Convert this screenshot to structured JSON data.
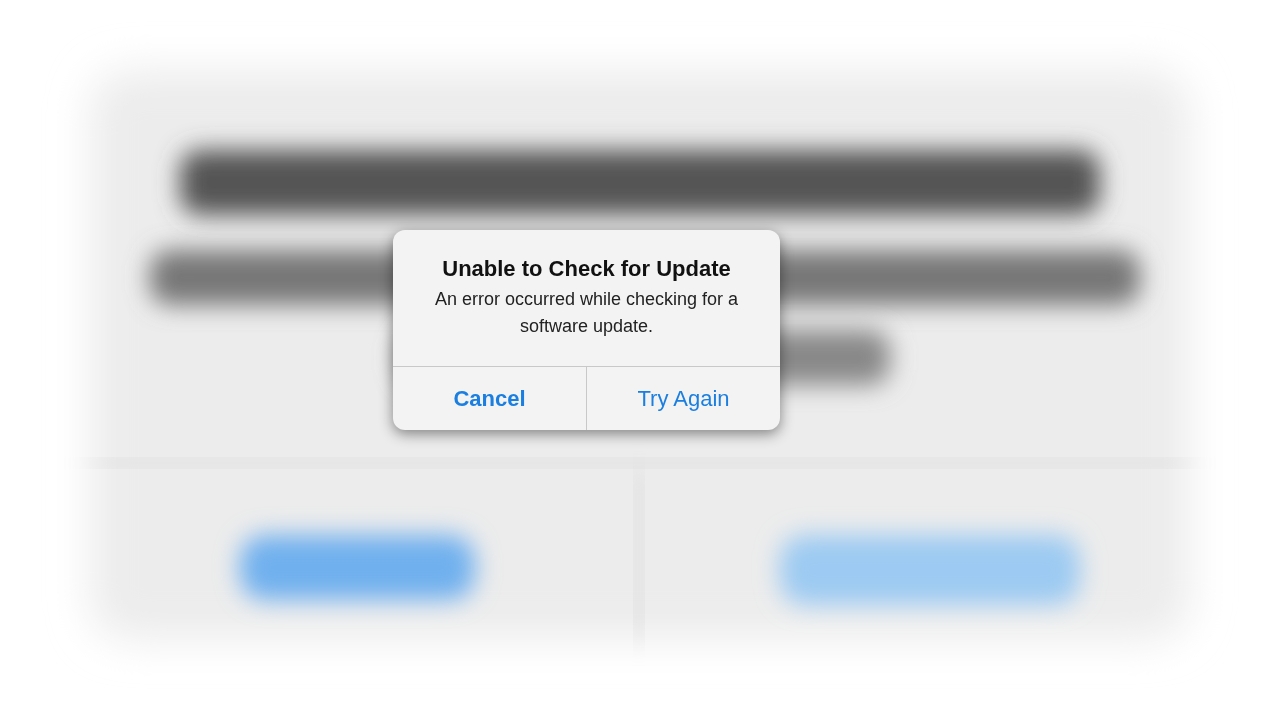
{
  "alert": {
    "title": "Unable to Check for Update",
    "message": "An error occurred while checking for a software update.",
    "buttons": [
      {
        "label": "Cancel",
        "preferred": true
      },
      {
        "label": "Try Again",
        "preferred": false
      }
    ]
  }
}
